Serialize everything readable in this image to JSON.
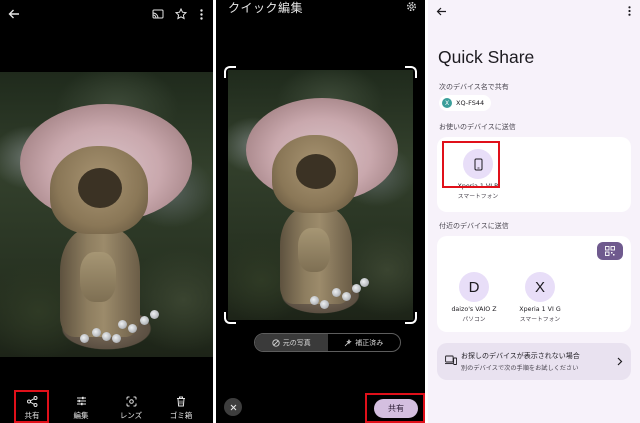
{
  "panel1": {
    "toolbar": [
      {
        "key": "share",
        "label": "共有",
        "icon": "share-icon"
      },
      {
        "key": "edit",
        "label": "編集",
        "icon": "sliders-icon"
      },
      {
        "key": "lens",
        "label": "レンズ",
        "icon": "lens-icon"
      },
      {
        "key": "trash",
        "label": "ゴミ箱",
        "icon": "trash-icon"
      }
    ],
    "top_icons": [
      "back-arrow-icon",
      "cast-icon",
      "star-icon",
      "more-vert-icon"
    ],
    "highlight_color": "#e0101a"
  },
  "panel2": {
    "title": "クイック編集",
    "toggle": {
      "original": "元の写真",
      "enhanced": "補正済み",
      "selected": "original"
    },
    "share_button": "共有",
    "icons": [
      "settings-icon",
      "close-icon",
      "original-photo-icon",
      "sparkle-icon"
    ]
  },
  "panel3": {
    "app_title": "Quick Share",
    "share_as_label": "次のデバイス名で共有",
    "device_name_chip": {
      "initial": "X",
      "name": "XQ-FS44"
    },
    "my_devices_label": "お使いのデバイスに送信",
    "my_devices": [
      {
        "name": "Xperia 1 VI R",
        "type": "スマートフォン",
        "icon": "phone-icon"
      }
    ],
    "nearby_label": "付近のデバイスに送信",
    "nearby_devices": [
      {
        "initial": "D",
        "name": "daizo's VAIO Z",
        "type": "パソコン"
      },
      {
        "initial": "X",
        "name": "Xperia 1 VI G",
        "type": "スマートフォン"
      }
    ],
    "help": {
      "title": "お探しのデバイスが表示されない場合",
      "subtitle": "別のデバイスで次の手順をお試しください"
    },
    "colors": {
      "background": "#f7f2fa",
      "accent": "#6f5a8e",
      "avatar": "#e8def8"
    }
  }
}
